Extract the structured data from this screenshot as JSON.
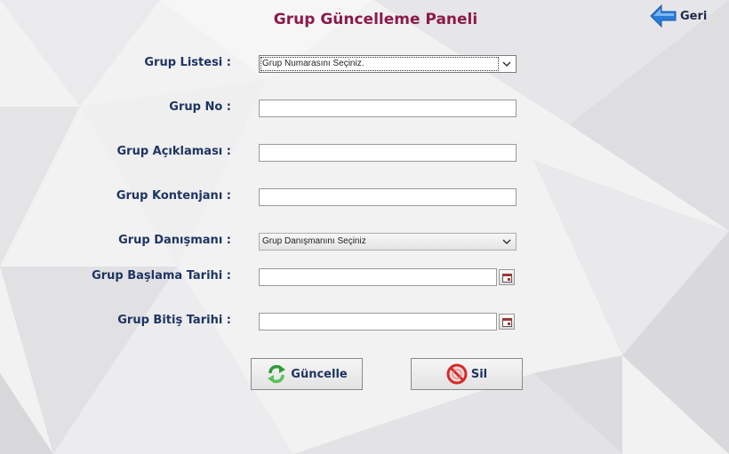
{
  "header": {
    "title": "Grup Güncelleme  Paneli",
    "back_label": "Geri"
  },
  "form": {
    "group_list_label": "Grup Listesi :",
    "group_list_selected": "Grup Numarasını Seçiniz.",
    "group_no_label": "Grup No :",
    "group_no_value": "",
    "description_label": "Grup Açıklaması :",
    "description_value": "",
    "quota_label": "Grup Kontenjanı :",
    "quota_value": "",
    "advisor_label": "Grup Danışmanı :",
    "advisor_selected": "Grup Danışmanını Seçiniz",
    "start_date_label": "Grup Başlama Tarihi :",
    "start_date_value": "",
    "end_date_label": "Grup Bitiş Tarihi :",
    "end_date_value": ""
  },
  "actions": {
    "update_label": "Güncelle",
    "delete_label": "Sil"
  },
  "icons": {
    "back": "arrow-left-icon",
    "calendar": "calendar-icon",
    "update": "refresh-icon",
    "delete": "delete-icon"
  },
  "colors": {
    "title": "#8b1a4b",
    "label": "#1f3462",
    "accent_blue": "#2b7bd8"
  }
}
